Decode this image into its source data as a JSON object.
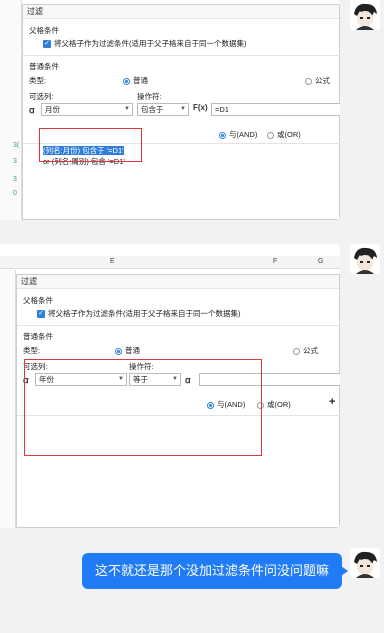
{
  "shot1": {
    "dialog_title": "过滤",
    "parent_section": "父格条件",
    "parent_checkbox_label": "将父格子作为过滤条件(适用于父子格来自于同一个数据集)",
    "normal_section": "普通条件",
    "type_label": "类型:",
    "type_normal": "普通",
    "type_formula": "公式",
    "optional_col_label": "可选列:",
    "operator_label": "操作符:",
    "column_value": "月份",
    "operator_value": "包含于",
    "formula_value": "=D1",
    "and_label": "与(AND)",
    "or_label": "或(OR)",
    "condition_line1": "(列名:月份) 包含于 '=D1'",
    "condition_line2": "or (列名:周别) 包含 '=D1'",
    "sheet_numbers": [
      "3(",
      "3",
      "3",
      "0"
    ]
  },
  "shot2": {
    "col_e": "E",
    "col_f": "F",
    "col_g": "G",
    "dialog_title": "过滤",
    "parent_section": "父格条件",
    "parent_checkbox_label": "将父格子作为过滤条件(适用于父子格来自于同一个数据集)",
    "normal_section": "普通条件",
    "type_label": "类型:",
    "type_normal": "普通",
    "type_formula": "公式",
    "optional_col_label": "可选列:",
    "operator_label": "操作符:",
    "column_value": "年份",
    "operator_value": "等于",
    "and_label": "与(AND)",
    "or_label": "或(OR)",
    "plus_label": "+"
  },
  "chat": {
    "message": "这不就还是那个没加过滤条件问没问题嘛"
  },
  "colors": {
    "accent": "#1f7bf6",
    "highlight_box": "#e0383e"
  }
}
